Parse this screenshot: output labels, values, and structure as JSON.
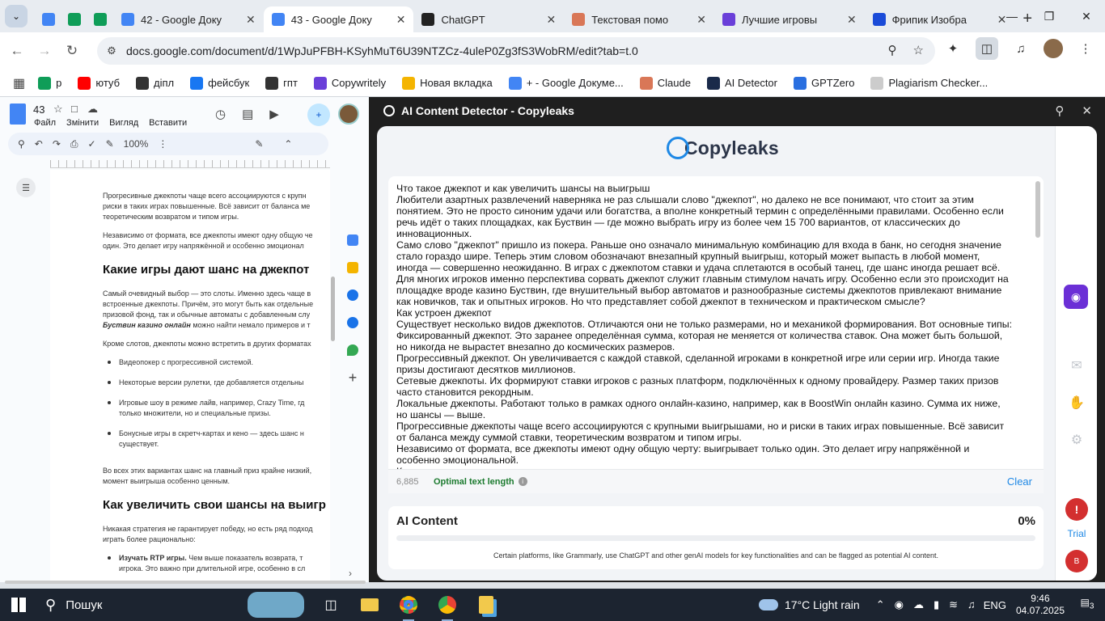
{
  "tabs": [
    {
      "title": "",
      "icon": "docs-icon",
      "color": "#4285f4"
    },
    {
      "title": "",
      "icon": "sheets-icon",
      "color": "#0f9d58"
    },
    {
      "title": "",
      "icon": "sheets-icon",
      "color": "#0f9d58"
    },
    {
      "title": "42 - Google Доку",
      "icon": "docs-icon",
      "color": "#4285f4"
    },
    {
      "title": "43 - Google Доку",
      "icon": "docs-icon",
      "color": "#4285f4",
      "active": true
    },
    {
      "title": "ChatGPT",
      "icon": "chatgpt-icon",
      "color": "#222222"
    },
    {
      "title": "Текстовая помо",
      "icon": "claude-icon",
      "color": "#d97757"
    },
    {
      "title": "Лучшие игровы",
      "icon": "game-icon",
      "color": "#6a3fd9"
    },
    {
      "title": "Фрипик Изобра",
      "icon": "freepik-icon",
      "color": "#1a4bd8"
    }
  ],
  "address": {
    "url": "docs.google.com/document/d/1WpJuPFBH-KSyhMuT6U39NTZCz-4uleP0Zg3fS3WobRM/edit?tab=t.0"
  },
  "bookmarks": [
    {
      "label": "р",
      "color": "#0f9d58"
    },
    {
      "label": "ютуб",
      "color": "#ff0000"
    },
    {
      "label": "діпл",
      "color": "#333333"
    },
    {
      "label": "фейсбук",
      "color": "#1877f2"
    },
    {
      "label": "гпт",
      "color": "#333333"
    },
    {
      "label": "Copywritely",
      "color": "#6a3fd9"
    },
    {
      "label": "Новая вкладка",
      "color": "#f4b400"
    },
    {
      "label": "+ - Google Докуме...",
      "color": "#4285f4"
    },
    {
      "label": "Claude",
      "color": "#d97757"
    },
    {
      "label": "AI Detector",
      "color": "#1a2a4a"
    },
    {
      "label": "GPTZero",
      "color": "#2a6fe0"
    },
    {
      "label": "Plagiarism Checker...",
      "color": "#cccccc"
    }
  ],
  "docs": {
    "title": "43",
    "menu": [
      "Файл",
      "Змінити",
      "Вигляд",
      "Вставити"
    ],
    "zoom": "100%",
    "content": {
      "p1": "Прогресивные джекпоты чаще всего ассоциируются с крупн",
      "p1b": "риски в таких играх повышенные. Всё зависит от баланса ме",
      "p1c": "теоретическим возвратом и типом игры.",
      "p2": "Независимо от формата, все джекпоты имеют одну общую че",
      "p2b": "один. Это делает игру напряжённой и особенно эмоционал",
      "h1": "Какие игры дают шанс на джекпот",
      "p3": "Самый очевидный выбор — это слоты. Именно здесь чаще в",
      "p3b": "встроенные джекпоты. Причём, это могут быть как отдельные",
      "p3c": "призовой фонд, так и обычные автоматы с добавленным слу",
      "p3d_bold": "Буствин казино онлайн",
      "p3d": " можно найти немало примеров и т",
      "p4": "Кроме слотов, джекпоты можно встретить в других форматах",
      "li1": "Видеопокер с прогрессивной системой.",
      "li2": "Некоторые версии рулетки, где добавляется отдельны",
      "li3": "Игровые шоу в режиме лайв, например, Crazy Time, гд",
      "li3b": "только множители, но и специальные призы.",
      "li4": "Бонусные игры в скретч-картах и кено — здесь шанс н",
      "li4b": "существует.",
      "p5": "Во всех этих вариантах шанс на главный приз крайне низкий,",
      "p5b": "момент выигрыша особенно ценным.",
      "h2": "Как увеличить свои шансы на выигр",
      "p6": "Никакая стратегия не гарантирует победу, но есть ряд подход",
      "p6b": "играть более рационально:",
      "li5_bold": "Изучать RTP игры.",
      "li5": " Чем выше показатель возврата, т",
      "li5b": "игрока. Это важно при длительной игре, особенно в сл"
    }
  },
  "sidebar": {
    "title": "AI Content Detector - Copyleaks",
    "logo": "Copyleaks",
    "text_lines": [
      "Что такое джекпот и как увеличить шансы на выигрыш",
      "Любители азартных развлечений наверняка не раз слышали слово \"джекпот\", но далеко не все понимают, что стоит за этим",
      "понятием. Это не просто синоним удачи или богатства, а вполне конкретный термин с определёнными правилами. Особенно если",
      "речь идёт о таких площадках, как Буствин — где можно выбрать игру из более чем 15 700 вариантов, от классических до",
      "инновационных.",
      "Само слово \"джекпот\" пришло из покера. Раньше оно означало минимальную комбинацию для входа в банк, но сегодня значение",
      "стало гораздо шире. Теперь этим словом обозначают внезапный крупный выигрыш, который может выпасть в любой момент,",
      "иногда — совершенно неожиданно. В играх с джекпотом ставки и удача сплетаются в особый танец, где шанс иногда решает всё.",
      "Для многих игроков именно перспектива сорвать джекпот служит главным стимулом начать игру. Особенно если это происходит на",
      "площадке вроде казино Буствин, где внушительный выбор автоматов и разнообразные системы джекпотов привлекают внимание",
      "как новичков, так и опытных игроков. Но что представляет собой джекпот в техническом и практическом смысле?",
      "Как устроен джекпот",
      "Существует несколько видов джекпотов. Отличаются они не только размерами, но и механикой формирования. Вот основные типы:",
      "Фиксированный джекпот. Это заранее определённая сумма, которая не меняется от количества ставок. Она может быть большой,",
      "но никогда не вырастет внезапно до космических размеров.",
      "Прогрессивный джекпот. Он увеличивается с каждой ставкой, сделанной игроками в конкретной игре или серии игр. Иногда такие",
      "призы достигают десятков миллионов.",
      "Сетевые джекпоты. Их формируют ставки игроков с разных платформ, подключённых к одному провайдеру. Размер таких призов",
      "часто становится рекордным.",
      "Локальные джекпоты. Работают только в рамках одного онлайн-казино, например, как в BoostWin онлайн казино. Сумма их ниже,",
      "но шансы — выше.",
      "Прогрессивные джекпоты чаще всего ассоциируются с крупными выигрышами, но и риски в таких играх повышенные. Всё зависит",
      "от баланса между суммой ставки, теоретическим возвратом и типом игры.",
      "Независимо от формата, все джекпоты имеют одну общую черту: выигрывает только один. Это делает игру напряжённой и",
      "особенно эмоциональной.",
      "Какие игры дают шанс на джекпот"
    ],
    "char_count": "6,885",
    "length_status": "Optimal text length",
    "clear_label": "Clear",
    "ai_label": "AI Content",
    "ai_percent": "0%",
    "ai_fraction": 0,
    "note": "Certain platforms, like Grammarly, use ChatGPT and other genAI models for key functionalities and can be flagged as potential AI content.",
    "trial_label": "Trial",
    "user_initial": "B",
    "accent": "#1e88e5",
    "eye_color": "#6b2fd6"
  },
  "taskbar": {
    "search_label": "Пошук",
    "weather": "17°C  Light rain",
    "lang": "ENG",
    "time": "9:46",
    "date": "04.07.2025",
    "notif_count": "3"
  }
}
